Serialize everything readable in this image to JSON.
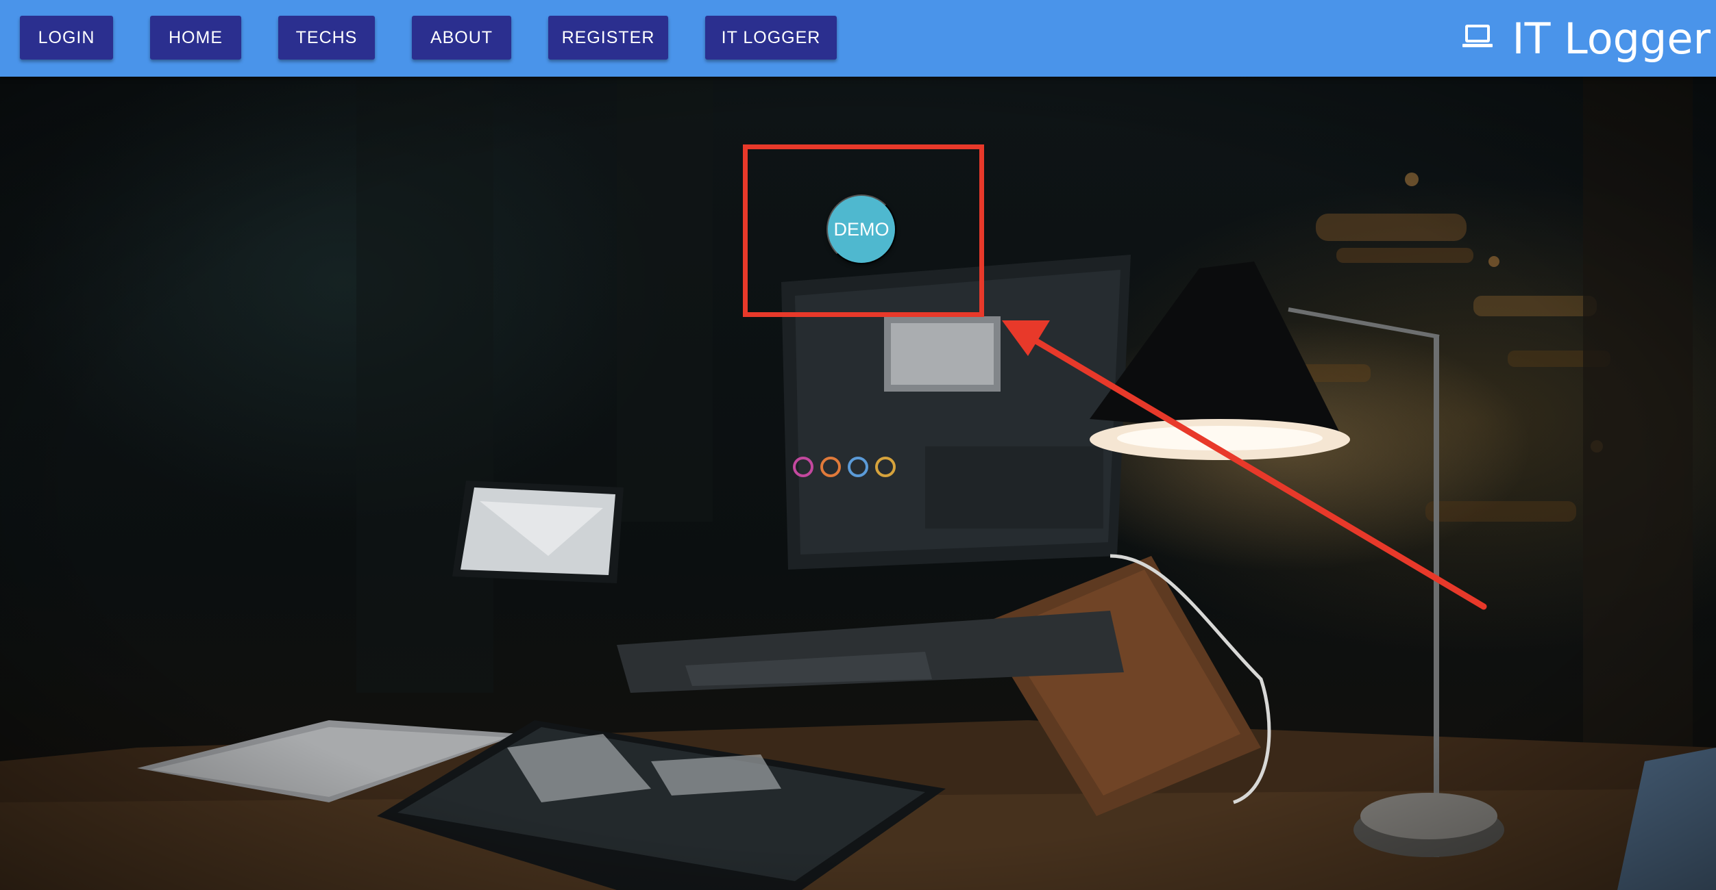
{
  "navbar": {
    "background_color": "#4a94ea",
    "button_color": "#2b2f8f",
    "buttons": [
      {
        "label": "LOGIN"
      },
      {
        "label": "HOME"
      },
      {
        "label": "TECHS"
      },
      {
        "label": "ABOUT"
      },
      {
        "label": "REGISTER"
      },
      {
        "label": "IT LOGGER"
      }
    ],
    "brand": {
      "icon": "laptop-icon",
      "title": "IT Logger"
    }
  },
  "hero": {
    "background_image": "night-desk-photo",
    "demo_button": {
      "label": "DEMO",
      "color": "#4fb8cf"
    },
    "annotation": {
      "highlight_color": "#e8392a",
      "shape": "rectangle-with-arrow"
    }
  }
}
